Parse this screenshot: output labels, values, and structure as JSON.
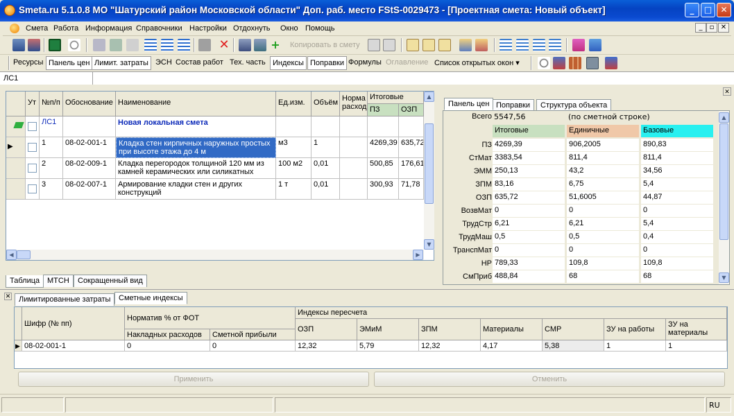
{
  "window": {
    "title": "Smeta.ru  5.1.0.8  МО \"Шатурский район Московской области\"  Доп. раб. место  FStS-0029473 - [Проектная смета: Новый объект]"
  },
  "menu": [
    "Смета",
    "Работа",
    "Информация",
    "Справочники",
    "Настройки",
    "Отдохнуть",
    "Окно",
    "Помощь"
  ],
  "toolbar1": {
    "copy_label": "Копировать в смету"
  },
  "toolbar2": {
    "buttons": [
      "Ресурсы",
      "Панель цен",
      "Лимит. затраты",
      "ЭСН",
      "Состав работ",
      "Тех. часть",
      "Индексы",
      "Поправки",
      "Формулы",
      "Оглавление",
      "Список открытых окон"
    ]
  },
  "address": "ЛС1",
  "estimate_table": {
    "headers": {
      "ut": "Ут",
      "num": "№п/п",
      "basis": "Обоснование",
      "name": "Наименование",
      "unit": "Ед.изм.",
      "volume": "Объём",
      "norm": "Норма расход",
      "totals": "Итоговые",
      "pz": "ПЗ",
      "ozp": "ОЗП"
    },
    "section": {
      "num": "ЛС1",
      "name": "Новая локальная смета"
    },
    "rows": [
      {
        "num": "1",
        "basis": "08-02-001-1",
        "name": "Кладка стен кирпичных наружных простых при высоте этажа до 4 м",
        "unit": "м3",
        "volume": "1",
        "pz": "4269,39",
        "ozp": "635,72"
      },
      {
        "num": "2",
        "basis": "08-02-009-1",
        "name": "Кладка перегородок толщиной 120 мм из камней керамических или силикатных",
        "unit": "100 м2",
        "volume": "0,01",
        "pz": "500,85",
        "ozp": "176,61"
      },
      {
        "num": "3",
        "basis": "08-02-007-1",
        "name": "Армирование кладки стен и других конструкций",
        "unit": "1 т",
        "volume": "0,01",
        "pz": "300,93",
        "ozp": "71,78"
      }
    ]
  },
  "bottom_tabs": [
    "Таблица",
    "МТСН",
    "Сокращенный вид"
  ],
  "right_panel": {
    "tabs": [
      "Панель цен",
      "Поправки",
      "Структура объекта"
    ],
    "total_label": "Всего",
    "total_value": "5547,56",
    "total_note": "(по сметной строке)",
    "col_headers": [
      "Итоговые",
      "Единичные",
      "Базовые"
    ],
    "rows": [
      {
        "label": "ПЗ",
        "v": [
          "4269,39",
          "906,2005",
          "890,83"
        ]
      },
      {
        "label": "СтМат",
        "v": [
          "3383,54",
          "811,4",
          "811,4"
        ]
      },
      {
        "label": "ЭММ",
        "v": [
          "250,13",
          "43,2",
          "34,56"
        ]
      },
      {
        "label": "ЗПМ",
        "v": [
          "83,16",
          "6,75",
          "5,4"
        ]
      },
      {
        "label": "ОЗП",
        "v": [
          "635,72",
          "51,6005",
          "44,87"
        ]
      },
      {
        "label": "ВозвМат",
        "v": [
          "0",
          "0",
          "0"
        ]
      },
      {
        "label": "ТрудСтр",
        "v": [
          "6,21",
          "6,21",
          "5,4"
        ]
      },
      {
        "label": "ТрудМаш",
        "v": [
          "0,5",
          "0,5",
          "0,4"
        ]
      },
      {
        "label": "ТранспМат",
        "v": [
          "0",
          "0",
          "0"
        ]
      },
      {
        "label": "НР",
        "v": [
          "789,33",
          "109,8",
          "109,8"
        ]
      },
      {
        "label": "СмПриб",
        "v": [
          "488,84",
          "68",
          "68"
        ]
      }
    ]
  },
  "lower": {
    "tabs": [
      "Лимитированные затраты",
      "Сметные индексы"
    ],
    "headers": {
      "cipher": "Шифр (№ пп)",
      "norm": "Норматив % от ФОТ",
      "overhead": "Накладных расходов",
      "profit": "Сметной прибыли",
      "indices": "Индексы пересчета",
      "ozp": "ОЗП",
      "emim": "ЭМиМ",
      "zpm": "ЗПМ",
      "materials": "Материалы",
      "smr": "СМР",
      "zu_work": "ЗУ на работы",
      "zu_mat": "ЗУ на материалы"
    },
    "row": {
      "cipher": "08-02-001-1",
      "overhead": "0",
      "profit": "0",
      "ozp": "12,32",
      "emim": "5,79",
      "zpm": "12,32",
      "materials": "4,17",
      "smr": "5,38",
      "zu_work": "1",
      "zu_mat": "1"
    },
    "apply_label": "Применить",
    "cancel_label": "Отменить"
  },
  "status": {
    "lang": "RU"
  },
  "colors": {
    "title_bar": "#0543c2",
    "selected_row": "#316ac5",
    "col_itog": "#c8e0c0",
    "col_edin": "#f0c8a8",
    "col_baz": "#28f0f0"
  }
}
